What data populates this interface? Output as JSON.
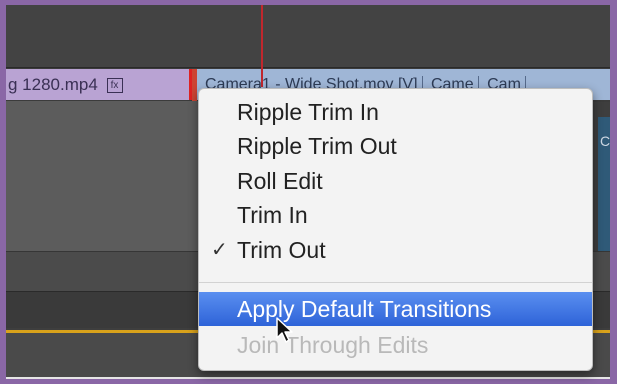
{
  "timeline": {
    "clip_left_label": "g 1280.mp4",
    "fx_badge": "fx",
    "clip_right_segments": [
      "Camera1 - Wide Shot.mov [V]",
      "Came",
      "Cam"
    ],
    "thumb_label": "Ca"
  },
  "context_menu": {
    "items": [
      {
        "label": "Ripple Trim In",
        "checked": false,
        "highlighted": false,
        "enabled": true
      },
      {
        "label": "Ripple Trim Out",
        "checked": false,
        "highlighted": false,
        "enabled": true
      },
      {
        "label": "Roll Edit",
        "checked": false,
        "highlighted": false,
        "enabled": true
      },
      {
        "label": "Trim In",
        "checked": false,
        "highlighted": false,
        "enabled": true
      },
      {
        "label": "Trim Out",
        "checked": true,
        "highlighted": false,
        "enabled": true
      }
    ],
    "check_glyph": "✓",
    "secondary_items": [
      {
        "label": "Apply Default Transitions",
        "highlighted": true,
        "enabled": true
      },
      {
        "label": "Join Through Edits",
        "highlighted": false,
        "enabled": false
      }
    ]
  },
  "colors": {
    "border": "#8a67a6",
    "highlight": "#2e63d8",
    "playhead": "#c0272d",
    "timeline_marker": "#d9a21b"
  }
}
